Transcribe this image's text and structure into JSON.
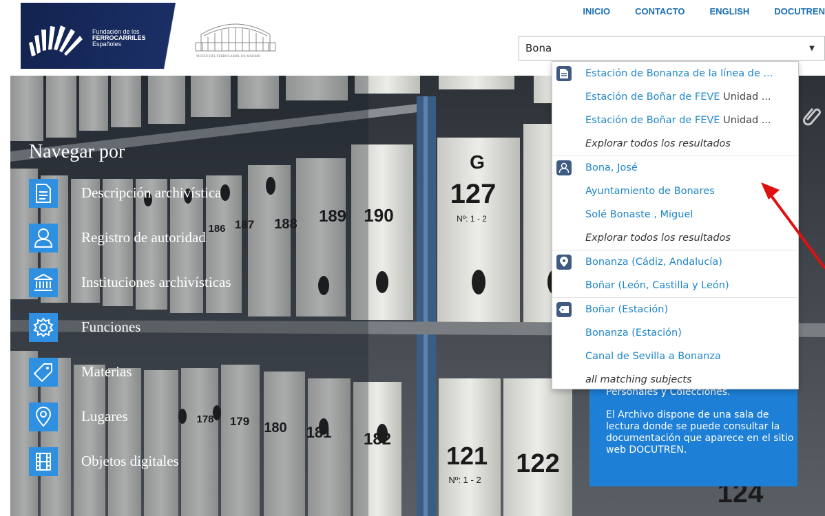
{
  "header": {
    "logo": {
      "line1": "Fundación de los",
      "line2": "FERROCARRILES",
      "line3": "Españoles",
      "museum_caption": "MUSEO DEL FERROCARRIL DE MADRID"
    },
    "nav": [
      "INICIO",
      "CONTACTO",
      "ENGLISH",
      "DOCUTREN"
    ],
    "search": {
      "value": "Bona",
      "caret_icon": "caret-down-icon"
    }
  },
  "browse": {
    "title": "Navegar por",
    "items": [
      {
        "label": "Descripción archivística",
        "icon": "document-icon"
      },
      {
        "label": "Registro de autoridad",
        "icon": "person-icon"
      },
      {
        "label": "Instituciones archivísticas",
        "icon": "institution-icon"
      },
      {
        "label": "Funciones",
        "icon": "gear-icon"
      },
      {
        "label": "Materias",
        "icon": "tag-icon"
      },
      {
        "label": "Lugares",
        "icon": "map-pin-icon"
      },
      {
        "label": "Objetos digitales",
        "icon": "film-icon"
      }
    ]
  },
  "info_panel": {
    "text1": "Personales y Colecciones.",
    "text2": "El Archivo dispone de una sala de lectura donde se puede consultar la documentación que aparece en el sitio web DOCUTREN."
  },
  "autocomplete": {
    "groups": [
      {
        "icon": "document-icon",
        "rows": [
          {
            "link": "Estación de Bonanza de la línea de ...",
            "extra": ""
          },
          {
            "link": "Estación de Boñar de FEVE",
            "extra": " Unidad ..."
          },
          {
            "link": "Estación de Boñar de FEVE",
            "extra": " Unidad ..."
          }
        ],
        "more": "Explorar todos los resultados"
      },
      {
        "icon": "person-icon",
        "rows": [
          {
            "link": "Bona, José",
            "extra": ""
          },
          {
            "link": "Ayuntamiento de Bonares",
            "extra": ""
          },
          {
            "link": "Solé Bonaste , Miguel",
            "extra": ""
          }
        ],
        "more": "Explorar todos los resultados"
      },
      {
        "icon": "map-pin-icon",
        "rows": [
          {
            "link": "Bonanza (Cádiz, Andalucía)",
            "extra": ""
          },
          {
            "link": "Boñar (León, Castilla y León)",
            "extra": ""
          }
        ],
        "more": ""
      },
      {
        "icon": "tag-icon",
        "rows": [
          {
            "link": "Boñar (Estación)",
            "extra": ""
          },
          {
            "link": "Bonanza (Estación)",
            "extra": ""
          },
          {
            "link": "Canal de Sevilla a Bonanza",
            "extra": ""
          }
        ],
        "more": "all matching subjects"
      }
    ]
  },
  "hero_boxes": {
    "labels": [
      "G",
      "127",
      "Nº: 1 - 2",
      "189",
      "190",
      "188",
      "187",
      "186",
      "181",
      "182",
      "180",
      "179",
      "178",
      "121",
      "122",
      "124",
      "Nº: 1 - 2"
    ]
  },
  "colors": {
    "brand_navy": "#1b2f66",
    "link_blue": "#1f86c8",
    "nav_blue": "#1a6fb5",
    "icon_blue": "#2f8fe0",
    "panel_blue": "#1e7fd6",
    "arrow_red": "#e01010"
  }
}
